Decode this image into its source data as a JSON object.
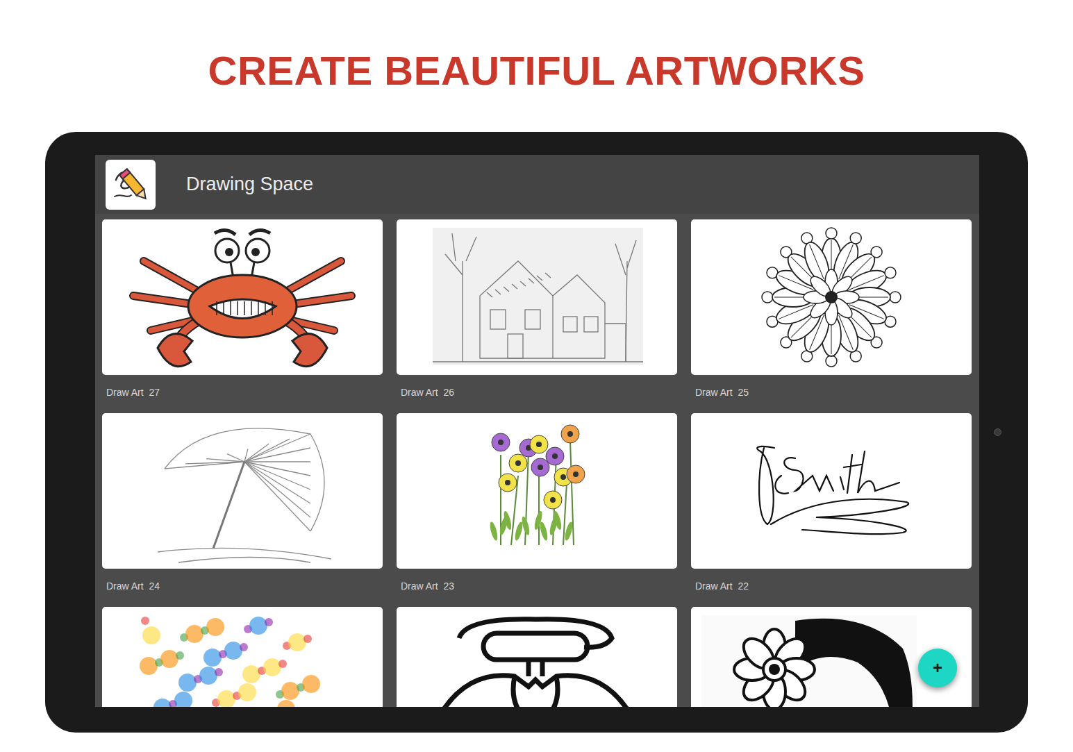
{
  "header": {
    "title": "CREATE BEAUTIFUL ARTWORKS"
  },
  "app_bar": {
    "title": "Drawing Space"
  },
  "artworks": [
    {
      "label": "Draw Art  27",
      "kind": "crab"
    },
    {
      "label": "Draw Art  26",
      "kind": "house"
    },
    {
      "label": "Draw Art  25",
      "kind": "mandala"
    },
    {
      "label": "Draw Art  24",
      "kind": "umbrella"
    },
    {
      "label": "Draw Art  23",
      "kind": "flowers"
    },
    {
      "label": "Draw Art  22",
      "kind": "signature"
    },
    {
      "kind": "splatter"
    },
    {
      "kind": "outline"
    },
    {
      "kind": "portrait"
    }
  ],
  "fab": {
    "label": "+"
  }
}
